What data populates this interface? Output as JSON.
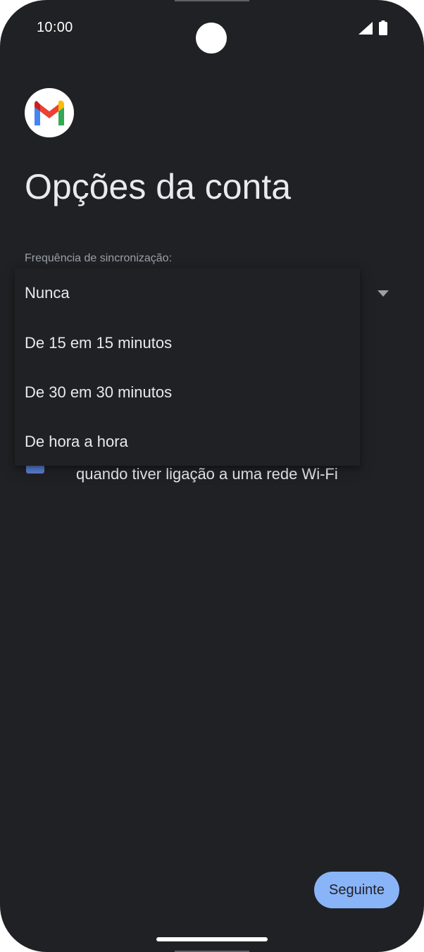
{
  "status_bar": {
    "time": "10:00",
    "signal_icon": "cellular-signal-icon",
    "battery_icon": "battery-full-icon"
  },
  "app": {
    "logo_icon": "gmail-logo-icon",
    "title": "Opções da conta"
  },
  "sync": {
    "label": "Frequência de sincronização:",
    "dropdown_arrow_icon": "dropdown-arrow-icon",
    "options": [
      "Nunca",
      "De 15 em 15 minutos",
      "De 30 em 30 minutos",
      "De hora a hora"
    ]
  },
  "attachments": {
    "checkbox_checked": true,
    "text_visible": "quando tiver ligação a uma rede Wi-Fi"
  },
  "footer": {
    "next_label": "Seguinte"
  },
  "colors": {
    "background": "#202124",
    "text_primary": "#e8eaed",
    "text_secondary": "#9aa0a6",
    "accent": "#8ab4f8",
    "checkbox": "#5b7fd6"
  }
}
